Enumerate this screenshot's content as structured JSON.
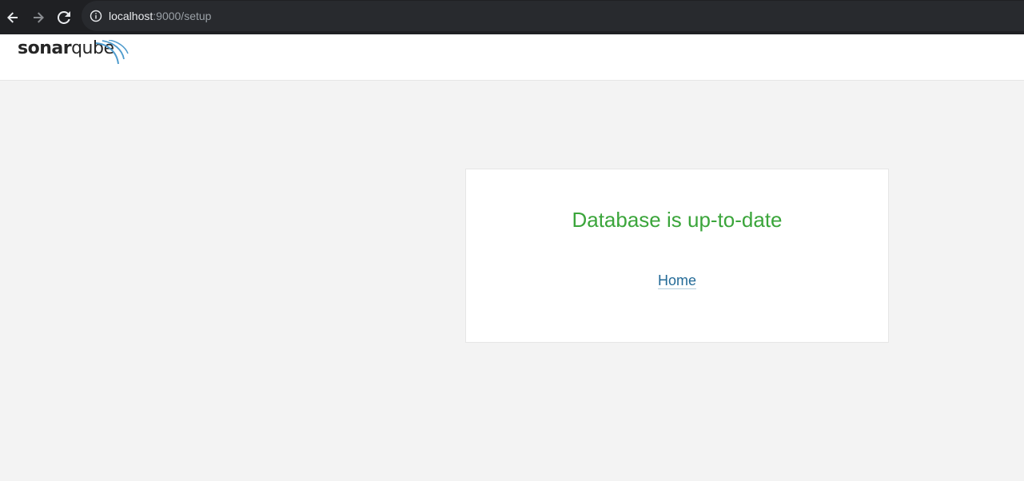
{
  "browser": {
    "url_host": "localhost",
    "url_rest": ":9000/setup"
  },
  "header": {
    "logo_sonar": "sonar",
    "logo_qube": "qube"
  },
  "main": {
    "title": "Database is up-to-date",
    "home_link": "Home"
  },
  "colors": {
    "success": "#3ba53b",
    "link": "#236a97",
    "background": "#f3f3f3"
  }
}
